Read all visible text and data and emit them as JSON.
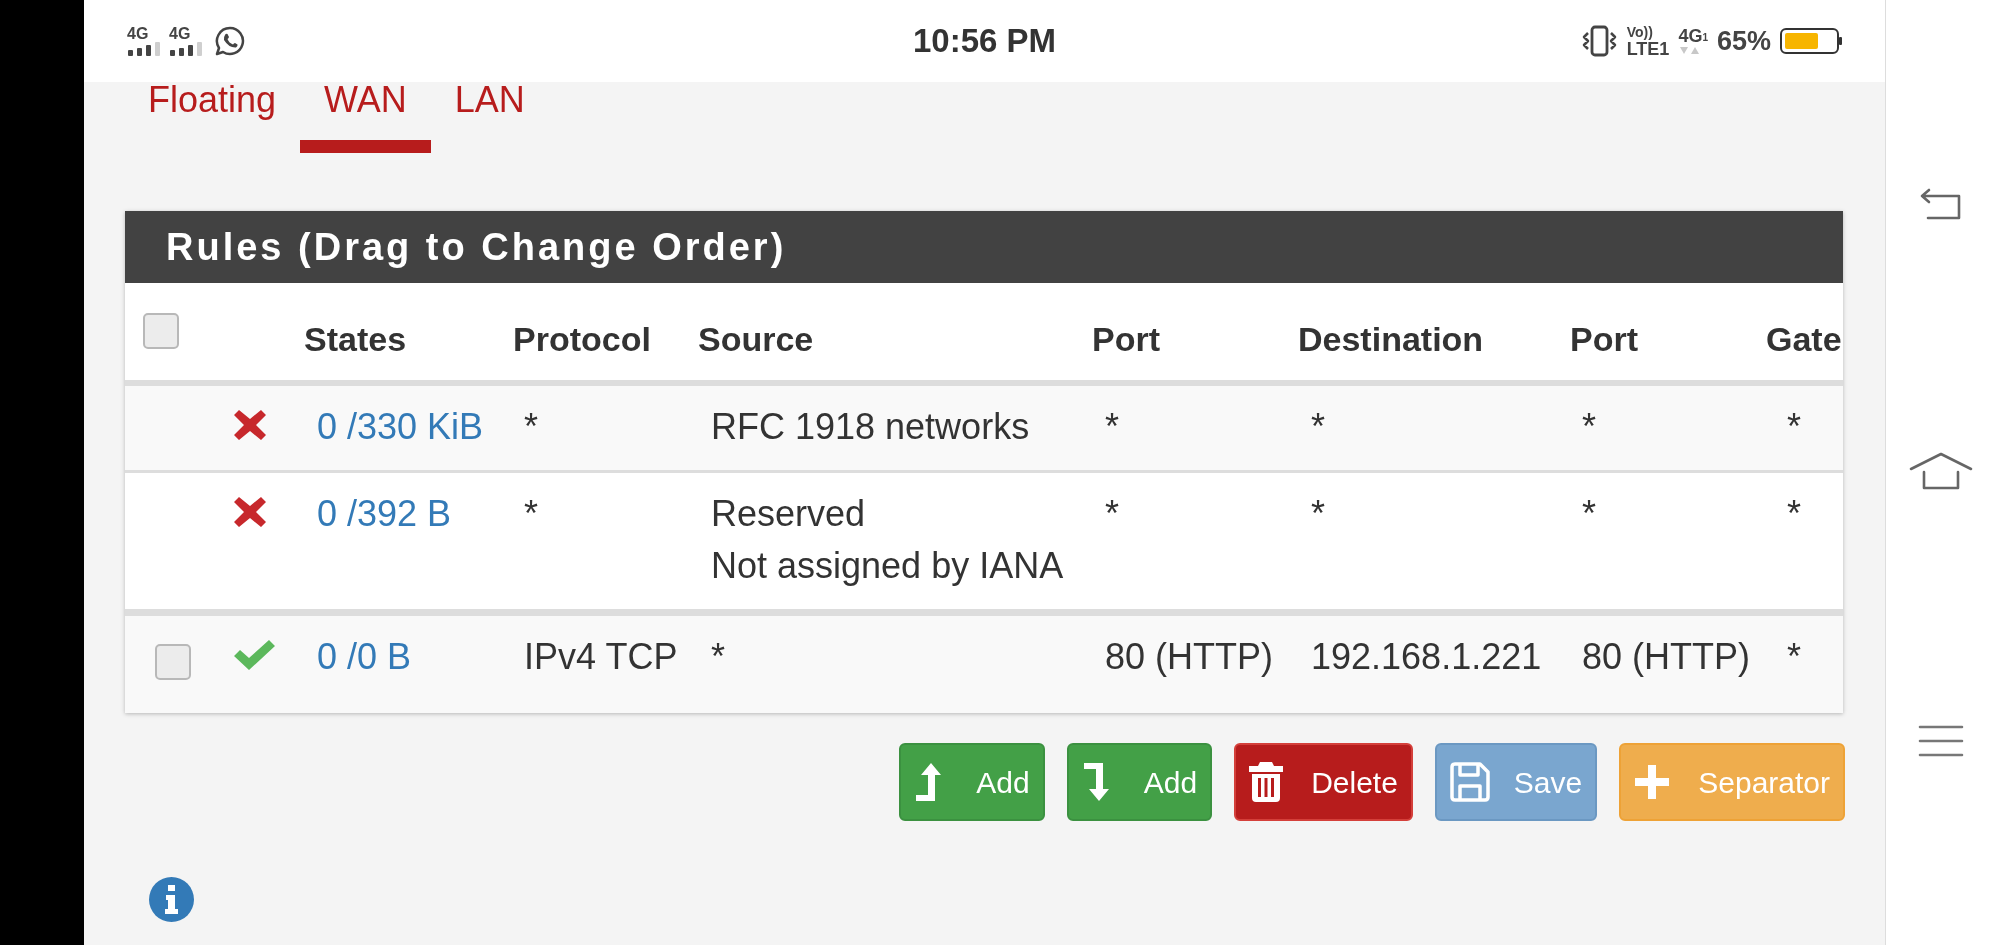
{
  "status_bar": {
    "signals": [
      "4G",
      "4G"
    ],
    "time": "10:56 PM",
    "volte": {
      "top": "Vo))",
      "bottom": "LTE1"
    },
    "mobile_data": {
      "label": "4G",
      "sim": "1"
    },
    "battery": "65%"
  },
  "tabs": [
    {
      "label": "Floating",
      "selected": false
    },
    {
      "label": "WAN",
      "selected": true
    },
    {
      "label": "LAN",
      "selected": false
    }
  ],
  "rules": {
    "title": "Rules (Drag to Change Order)",
    "select_all": {
      "checked": false
    },
    "columns": [
      "States",
      "Protocol",
      "Source",
      "Port",
      "Destination",
      "Port",
      "Gate"
    ],
    "rows": [
      {
        "kind": "block",
        "states": "0 /330 KiB",
        "protocol": "*",
        "source": [
          "RFC 1918 networks"
        ],
        "port": "*",
        "destination": "*",
        "destination_port": "*",
        "gateway": "*"
      },
      {
        "kind": "block",
        "states": "0 /392 B",
        "protocol": "*",
        "source": [
          "Reserved",
          "Not assigned by IANA"
        ],
        "port": "*",
        "destination": "*",
        "destination_port": "*",
        "gateway": "*"
      },
      {
        "kind": "pass",
        "checkbox": {
          "checked": false
        },
        "states": "0 /0 B",
        "protocol": "IPv4 TCP",
        "source": [
          "*"
        ],
        "port": "80 (HTTP)",
        "destination": "192.168.1.221",
        "destination_port": "80 (HTTP)",
        "gateway": "*"
      }
    ]
  },
  "buttons": [
    {
      "kind": "add_top",
      "label": "Add"
    },
    {
      "kind": "add_bottom",
      "label": "Add"
    },
    {
      "kind": "delete",
      "label": "Delete"
    },
    {
      "kind": "save",
      "label": "Save"
    },
    {
      "kind": "separator",
      "label": "Separator"
    }
  ]
}
